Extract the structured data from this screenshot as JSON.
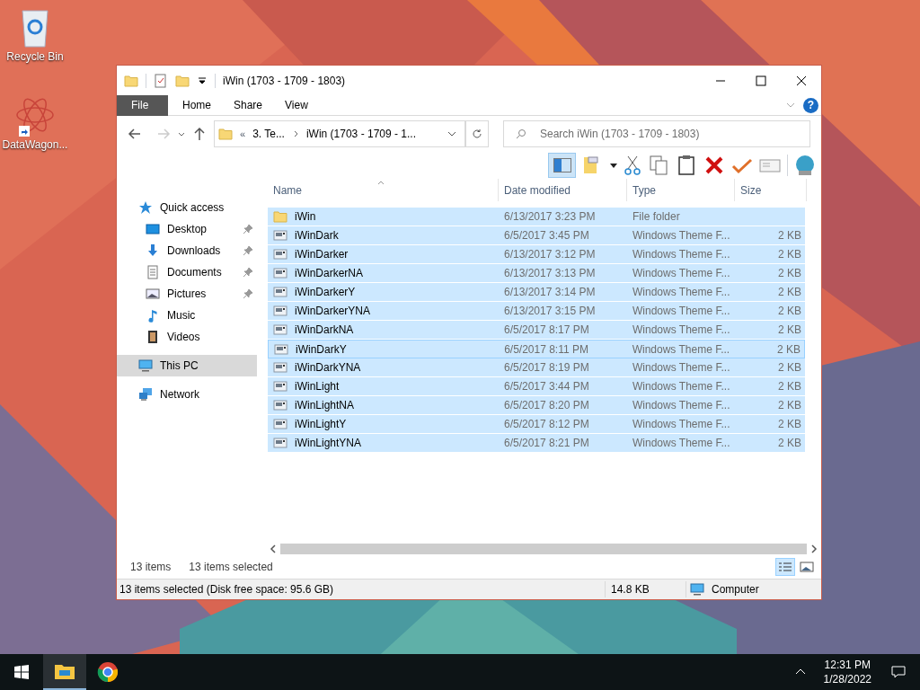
{
  "desktop_icons": [
    {
      "kind": "recycle",
      "label": "Recycle Bin"
    },
    {
      "kind": "shortcut",
      "label": "DataWagon..."
    }
  ],
  "window": {
    "title": "iWin (1703 - 1709 - 1803)",
    "help": "?"
  },
  "ribbon_tabs": [
    {
      "label": "File",
      "selected": true
    },
    {
      "label": "Home",
      "selected": false
    },
    {
      "label": "Share",
      "selected": false
    },
    {
      "label": "View",
      "selected": false
    }
  ],
  "address": {
    "overflow": "«",
    "crumbs": [
      "3. Te...",
      "iWin (1703 - 1709 - 1..."
    ]
  },
  "search": {
    "placeholder": "Search iWin (1703 - 1709 - 1803)"
  },
  "sidebar": [
    {
      "label": "Quick access",
      "kind": "star",
      "selected": false,
      "children": [
        {
          "label": "Desktop",
          "kind": "desktop",
          "pinned": true,
          "selected": false
        },
        {
          "label": "Downloads",
          "kind": "download",
          "pinned": true,
          "selected": false
        },
        {
          "label": "Documents",
          "kind": "document",
          "pinned": true,
          "selected": false
        },
        {
          "label": "Pictures",
          "kind": "pictures",
          "pinned": true,
          "selected": false
        },
        {
          "label": "Music",
          "kind": "music",
          "pinned": false,
          "selected": false
        },
        {
          "label": "Videos",
          "kind": "video",
          "pinned": false,
          "selected": false
        }
      ]
    },
    {
      "label": "This PC",
      "kind": "pc",
      "selected": true
    },
    {
      "label": "Network",
      "kind": "network",
      "selected": false
    }
  ],
  "table": {
    "columns": [
      "Name",
      "Date modified",
      "Type",
      "Size"
    ],
    "rows": [
      {
        "kind": "folder",
        "name": "iWin",
        "date": "6/13/2017 3:23 PM",
        "type": "File folder",
        "selected": true,
        "focused": false
      },
      {
        "kind": "file",
        "name": "iWinDark",
        "date": "6/5/2017 3:45 PM",
        "type": "Windows Theme F...",
        "size": "2 KB",
        "selected": true,
        "focused": false
      },
      {
        "kind": "file",
        "name": "iWinDarker",
        "date": "6/13/2017 3:12 PM",
        "type": "Windows Theme F...",
        "size": "2 KB",
        "selected": true,
        "focused": false
      },
      {
        "kind": "file",
        "name": "iWinDarkerNA",
        "date": "6/13/2017 3:13 PM",
        "type": "Windows Theme F...",
        "size": "2 KB",
        "selected": true,
        "focused": false
      },
      {
        "kind": "file",
        "name": "iWinDarkerY",
        "date": "6/13/2017 3:14 PM",
        "type": "Windows Theme F...",
        "size": "2 KB",
        "selected": true,
        "focused": false
      },
      {
        "kind": "file",
        "name": "iWinDarkerYNA",
        "date": "6/13/2017 3:15 PM",
        "type": "Windows Theme F...",
        "size": "2 KB",
        "selected": true,
        "focused": false
      },
      {
        "kind": "file",
        "name": "iWinDarkNA",
        "date": "6/5/2017 8:17 PM",
        "type": "Windows Theme F...",
        "size": "2 KB",
        "selected": true,
        "focused": false
      },
      {
        "kind": "file",
        "name": "iWinDarkY",
        "date": "6/5/2017 8:11 PM",
        "type": "Windows Theme F...",
        "size": "2 KB",
        "selected": true,
        "focused": true
      },
      {
        "kind": "file",
        "name": "iWinDarkYNA",
        "date": "6/5/2017 8:19 PM",
        "type": "Windows Theme F...",
        "size": "2 KB",
        "selected": true,
        "focused": false
      },
      {
        "kind": "file",
        "name": "iWinLight",
        "date": "6/5/2017 3:44 PM",
        "type": "Windows Theme F...",
        "size": "2 KB",
        "selected": true,
        "focused": false
      },
      {
        "kind": "file",
        "name": "iWinLightNA",
        "date": "6/5/2017 8:20 PM",
        "type": "Windows Theme F...",
        "size": "2 KB",
        "selected": true,
        "focused": false
      },
      {
        "kind": "file",
        "name": "iWinLightY",
        "date": "6/5/2017 8:12 PM",
        "type": "Windows Theme F...",
        "size": "2 KB",
        "selected": true,
        "focused": false
      },
      {
        "kind": "file",
        "name": "iWinLightYNA",
        "date": "6/5/2017 8:21 PM",
        "type": "Windows Theme F...",
        "size": "2 KB",
        "selected": true,
        "focused": false
      }
    ]
  },
  "item_count": "13 items",
  "selection_count": "13 items selected",
  "view_buttons": [
    {
      "kind": "details",
      "selected": true
    },
    {
      "kind": "thumbnails",
      "selected": false
    }
  ],
  "status_bar": {
    "message": "13 items selected (Disk free space: 95.6 GB)",
    "size": "14.8 KB",
    "location": "Computer"
  },
  "taskbar": {
    "apps": [
      {
        "kind": "explorer",
        "selected": true
      },
      {
        "kind": "browser",
        "selected": false
      }
    ],
    "time": "12:31 PM",
    "date": "1/28/2022"
  }
}
